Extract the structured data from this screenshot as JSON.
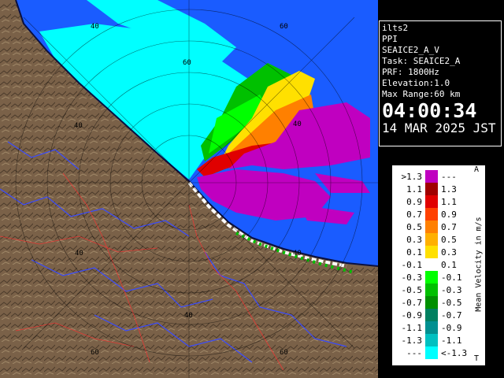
{
  "info": {
    "site": "ilts2",
    "mode": "PPI",
    "product": "SEAICE2_A_V",
    "task": "Task: SEAICE2_A",
    "prf": "PRF: 1800Hz",
    "elevation": "Elevation:1.0",
    "max_range": "Max Range:60 km",
    "time": "04:00:34",
    "date": "14 MAR 2025 JST"
  },
  "range_rings": {
    "labels": [
      "40",
      "60",
      "60",
      "40",
      "40",
      "40",
      "40",
      "60",
      "40",
      "60"
    ]
  },
  "legend": {
    "unit": "Mean Velocity in m/s",
    "top_marker": "A",
    "bottom_marker": "T",
    "rows": [
      {
        "lo": ">1.3",
        "hi": "---",
        "color": "#c000c0"
      },
      {
        "lo": "1.1",
        "hi": "1.3",
        "color": "#a00000"
      },
      {
        "lo": "0.9",
        "hi": "1.1",
        "color": "#e00000"
      },
      {
        "lo": "0.7",
        "hi": "0.9",
        "color": "#ff4000"
      },
      {
        "lo": "0.5",
        "hi": "0.7",
        "color": "#ff8000"
      },
      {
        "lo": "0.3",
        "hi": "0.5",
        "color": "#ffb000"
      },
      {
        "lo": "0.1",
        "hi": "0.3",
        "color": "#ffe000"
      },
      {
        "lo": "-0.1",
        "hi": "0.1",
        "color": "#ffffff"
      },
      {
        "lo": "-0.3",
        "hi": "-0.1",
        "color": "#00ff00"
      },
      {
        "lo": "-0.5",
        "hi": "-0.3",
        "color": "#00c000"
      },
      {
        "lo": "-0.7",
        "hi": "-0.5",
        "color": "#009000"
      },
      {
        "lo": "-0.9",
        "hi": "-0.7",
        "color": "#008060"
      },
      {
        "lo": "-1.1",
        "hi": "-0.9",
        "color": "#009090"
      },
      {
        "lo": "-1.3",
        "hi": "-1.1",
        "color": "#00c0c0"
      },
      {
        "lo": "---",
        "hi": "<-1.3",
        "color": "#00ffff"
      }
    ]
  },
  "colors": {
    "sea_clutter_blue": "#1a5cff",
    "land": "#7a6148",
    "far_cyan": "#00ffff",
    "rivers": "#3a4cff",
    "roads": "#ff3030"
  }
}
